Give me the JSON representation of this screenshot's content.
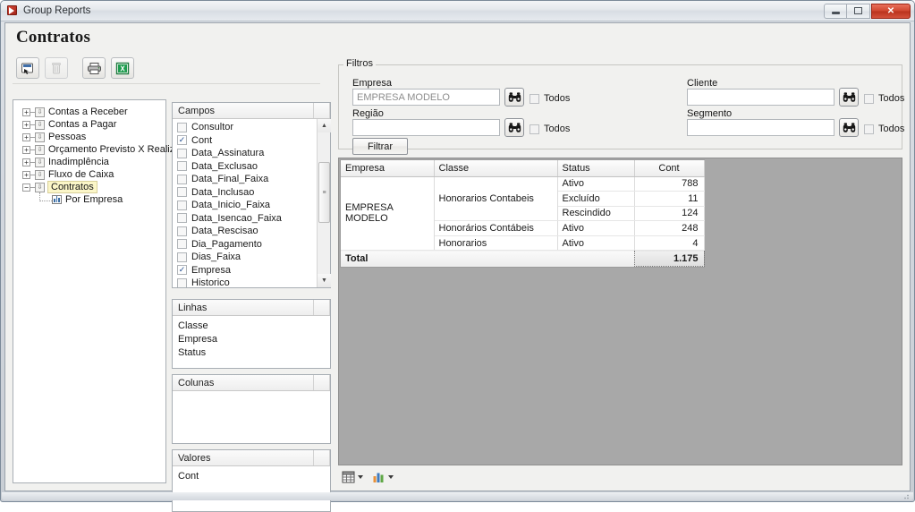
{
  "window": {
    "title": "Group Reports",
    "app_icon": "app-icon",
    "buttons": {
      "minimize": "minimize",
      "maximize": "maximize",
      "close": "✕"
    }
  },
  "page": {
    "title": "Contratos"
  },
  "toolbar": {
    "buttons": [
      {
        "name": "refresh-data-button",
        "icon": "refresh-cursor-icon",
        "enabled": true
      },
      {
        "name": "delete-button",
        "icon": "trash-icon",
        "enabled": false
      },
      {
        "name": "print-button",
        "icon": "printer-icon",
        "enabled": true
      },
      {
        "name": "export-excel-button",
        "icon": "excel-icon",
        "enabled": true
      }
    ]
  },
  "tree": {
    "items": [
      {
        "label": "Contas a Receber",
        "expanded": false,
        "selected": false
      },
      {
        "label": "Contas a Pagar",
        "expanded": false,
        "selected": false
      },
      {
        "label": "Pessoas",
        "expanded": false,
        "selected": false
      },
      {
        "label": "Orçamento Previsto X Realizado",
        "expanded": false,
        "selected": false
      },
      {
        "label": "Inadimplência",
        "expanded": false,
        "selected": false
      },
      {
        "label": "Fluxo de Caixa",
        "expanded": false,
        "selected": false
      },
      {
        "label": "Contratos",
        "expanded": true,
        "selected": true
      }
    ],
    "child": {
      "label": "Por Empresa",
      "parent": "Contratos"
    }
  },
  "campos": {
    "header": "Campos",
    "fields": [
      {
        "label": "Consultor",
        "checked": false
      },
      {
        "label": "Cont",
        "checked": true
      },
      {
        "label": "Data_Assinatura",
        "checked": false
      },
      {
        "label": "Data_Exclusao",
        "checked": false
      },
      {
        "label": "Data_Final_Faixa",
        "checked": false
      },
      {
        "label": "Data_Inclusao",
        "checked": false
      },
      {
        "label": "Data_Inicio_Faixa",
        "checked": false
      },
      {
        "label": "Data_Isencao_Faixa",
        "checked": false
      },
      {
        "label": "Data_Rescisao",
        "checked": false
      },
      {
        "label": "Dia_Pagamento",
        "checked": false
      },
      {
        "label": "Dias_Faixa",
        "checked": false
      },
      {
        "label": "Empresa",
        "checked": true
      },
      {
        "label": "Historico",
        "checked": false
      }
    ]
  },
  "linhas": {
    "header": "Linhas",
    "items": [
      "Classe",
      "Empresa",
      "Status"
    ]
  },
  "colunas": {
    "header": "Colunas",
    "items": []
  },
  "valores": {
    "header": "Valores",
    "items": [
      "Cont"
    ]
  },
  "filtros": {
    "legend": "Filtros",
    "fields": [
      {
        "label": "Empresa",
        "value": "EMPRESA MODELO",
        "placeholder": "",
        "todos_label": "Todos",
        "todos_checked": false,
        "lookup_icon": "binoculars-icon"
      },
      {
        "label": "Região",
        "value": "",
        "placeholder": "",
        "todos_label": "Todos",
        "todos_checked": false,
        "lookup_icon": "binoculars-icon"
      },
      {
        "label": "Cliente",
        "value": "",
        "placeholder": "",
        "todos_label": "Todos",
        "todos_checked": false,
        "lookup_icon": "binoculars-icon"
      },
      {
        "label": "Segmento",
        "value": "",
        "placeholder": "",
        "todos_label": "Todos",
        "todos_checked": false,
        "lookup_icon": "binoculars-icon"
      }
    ],
    "filter_button": "Filtrar"
  },
  "grid": {
    "columns": [
      "Empresa",
      "Classe",
      "Status",
      "Cont"
    ],
    "rows": [
      {
        "empresa": "EMPRESA MODELO",
        "classe": "Honorarios Contabeis",
        "status": "Ativo",
        "cont": "788"
      },
      {
        "empresa": "",
        "classe": "",
        "status": "Excluído",
        "cont": "11"
      },
      {
        "empresa": "",
        "classe": "",
        "status": "Rescindido",
        "cont": "124"
      },
      {
        "empresa": "",
        "classe": "Honorários Contábeis",
        "status": "Ativo",
        "cont": "248"
      },
      {
        "empresa": "",
        "classe": "Honorarios",
        "status": "Ativo",
        "cont": "4"
      }
    ],
    "total_label": "Total",
    "total_value": "1.175"
  },
  "statusstrip": {
    "items": [
      {
        "name": "grid-view-button",
        "icon": "table-grid-icon"
      },
      {
        "name": "chart-view-button",
        "icon": "bar-chart-icon"
      }
    ]
  },
  "colors": {
    "accent_close": "#c0392b",
    "selection_highlight": "#fbf6c8",
    "pivot_background": "#a8a8a8",
    "excel_green": "#1f7a3f",
    "chart_orange": "#e8913a"
  }
}
